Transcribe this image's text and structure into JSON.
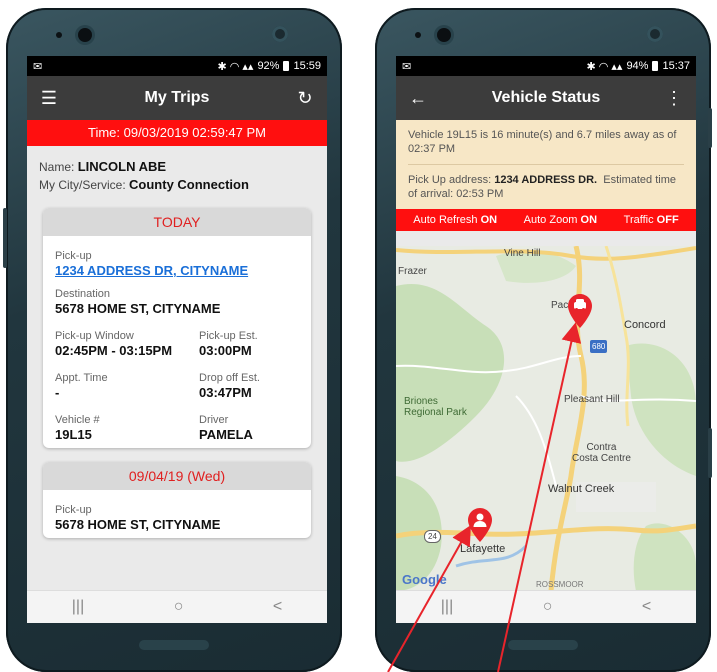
{
  "left_phone": {
    "status": {
      "battery_pct": "92%",
      "time": "15:59"
    },
    "appbar": {
      "title": "My Trips"
    },
    "time_banner": "Time: 09/03/2019 02:59:47 PM",
    "person": {
      "name_label": "Name:",
      "name": "LINCOLN ABE",
      "city_label": "My City/Service:",
      "city": "County Connection"
    },
    "cards": [
      {
        "header": "TODAY",
        "pickup_label": "Pick-up",
        "pickup": "1234 ADDRESS DR, CITYNAME",
        "destination_label": "Destination",
        "destination": "5678 HOME ST, CITYNAME",
        "window_label": "Pick-up Window",
        "window": "02:45PM - 03:15PM",
        "pickup_est_label": "Pick-up Est.",
        "pickup_est": "03:00PM",
        "appt_label": "Appt. Time",
        "appt": "-",
        "dropoff_label": "Drop off Est.",
        "dropoff": "03:47PM",
        "vehicle_label": "Vehicle #",
        "vehicle": "19L15",
        "driver_label": "Driver",
        "driver": "PAMELA"
      },
      {
        "header": "09/04/19 (Wed)",
        "pickup_label": "Pick-up",
        "pickup": "5678 HOME ST, CITYNAME"
      }
    ],
    "nav": {
      "recent": "|||",
      "home": "○",
      "back": "<"
    }
  },
  "right_phone": {
    "status": {
      "battery_pct": "94%",
      "time": "15:37"
    },
    "appbar": {
      "title": "Vehicle Status"
    },
    "info": {
      "line1": "Vehicle 19L15 is 16 minute(s) and 6.7 miles away as of 02:37 PM",
      "pickup_prefix": "Pick Up address: ",
      "pickup_address": "1234 ADDRESS DR.",
      "eta": "Estimated time of arrival: 02:53 PM"
    },
    "toggles": [
      {
        "label": "Auto Refresh",
        "state": "ON"
      },
      {
        "label": "Auto Zoom",
        "state": "ON"
      },
      {
        "label": "Traffic",
        "state": "OFF"
      }
    ],
    "map_labels": {
      "vine_hill": "Vine Hill",
      "frazer": "Frazer",
      "pacheco": "Pach",
      "concord": "Concord",
      "hw680": "680",
      "briones": "Briones\nRegional Park",
      "pleasant_hill": "Pleasant Hill",
      "contra_costa": "Contra\nCosta Centre",
      "walnut_creek": "Walnut Creek",
      "lafayette": "Lafayette",
      "hw24": "24",
      "rossmoor": "ROSSMOOR",
      "google": "Google"
    },
    "nav": {
      "recent": "|||",
      "home": "○",
      "back": "<"
    }
  },
  "colors": {
    "accent_red": "#ff0f0f",
    "link_blue": "#1a6fd8",
    "info_bg": "#f7e7c6",
    "appbar": "#3c3c3c"
  }
}
